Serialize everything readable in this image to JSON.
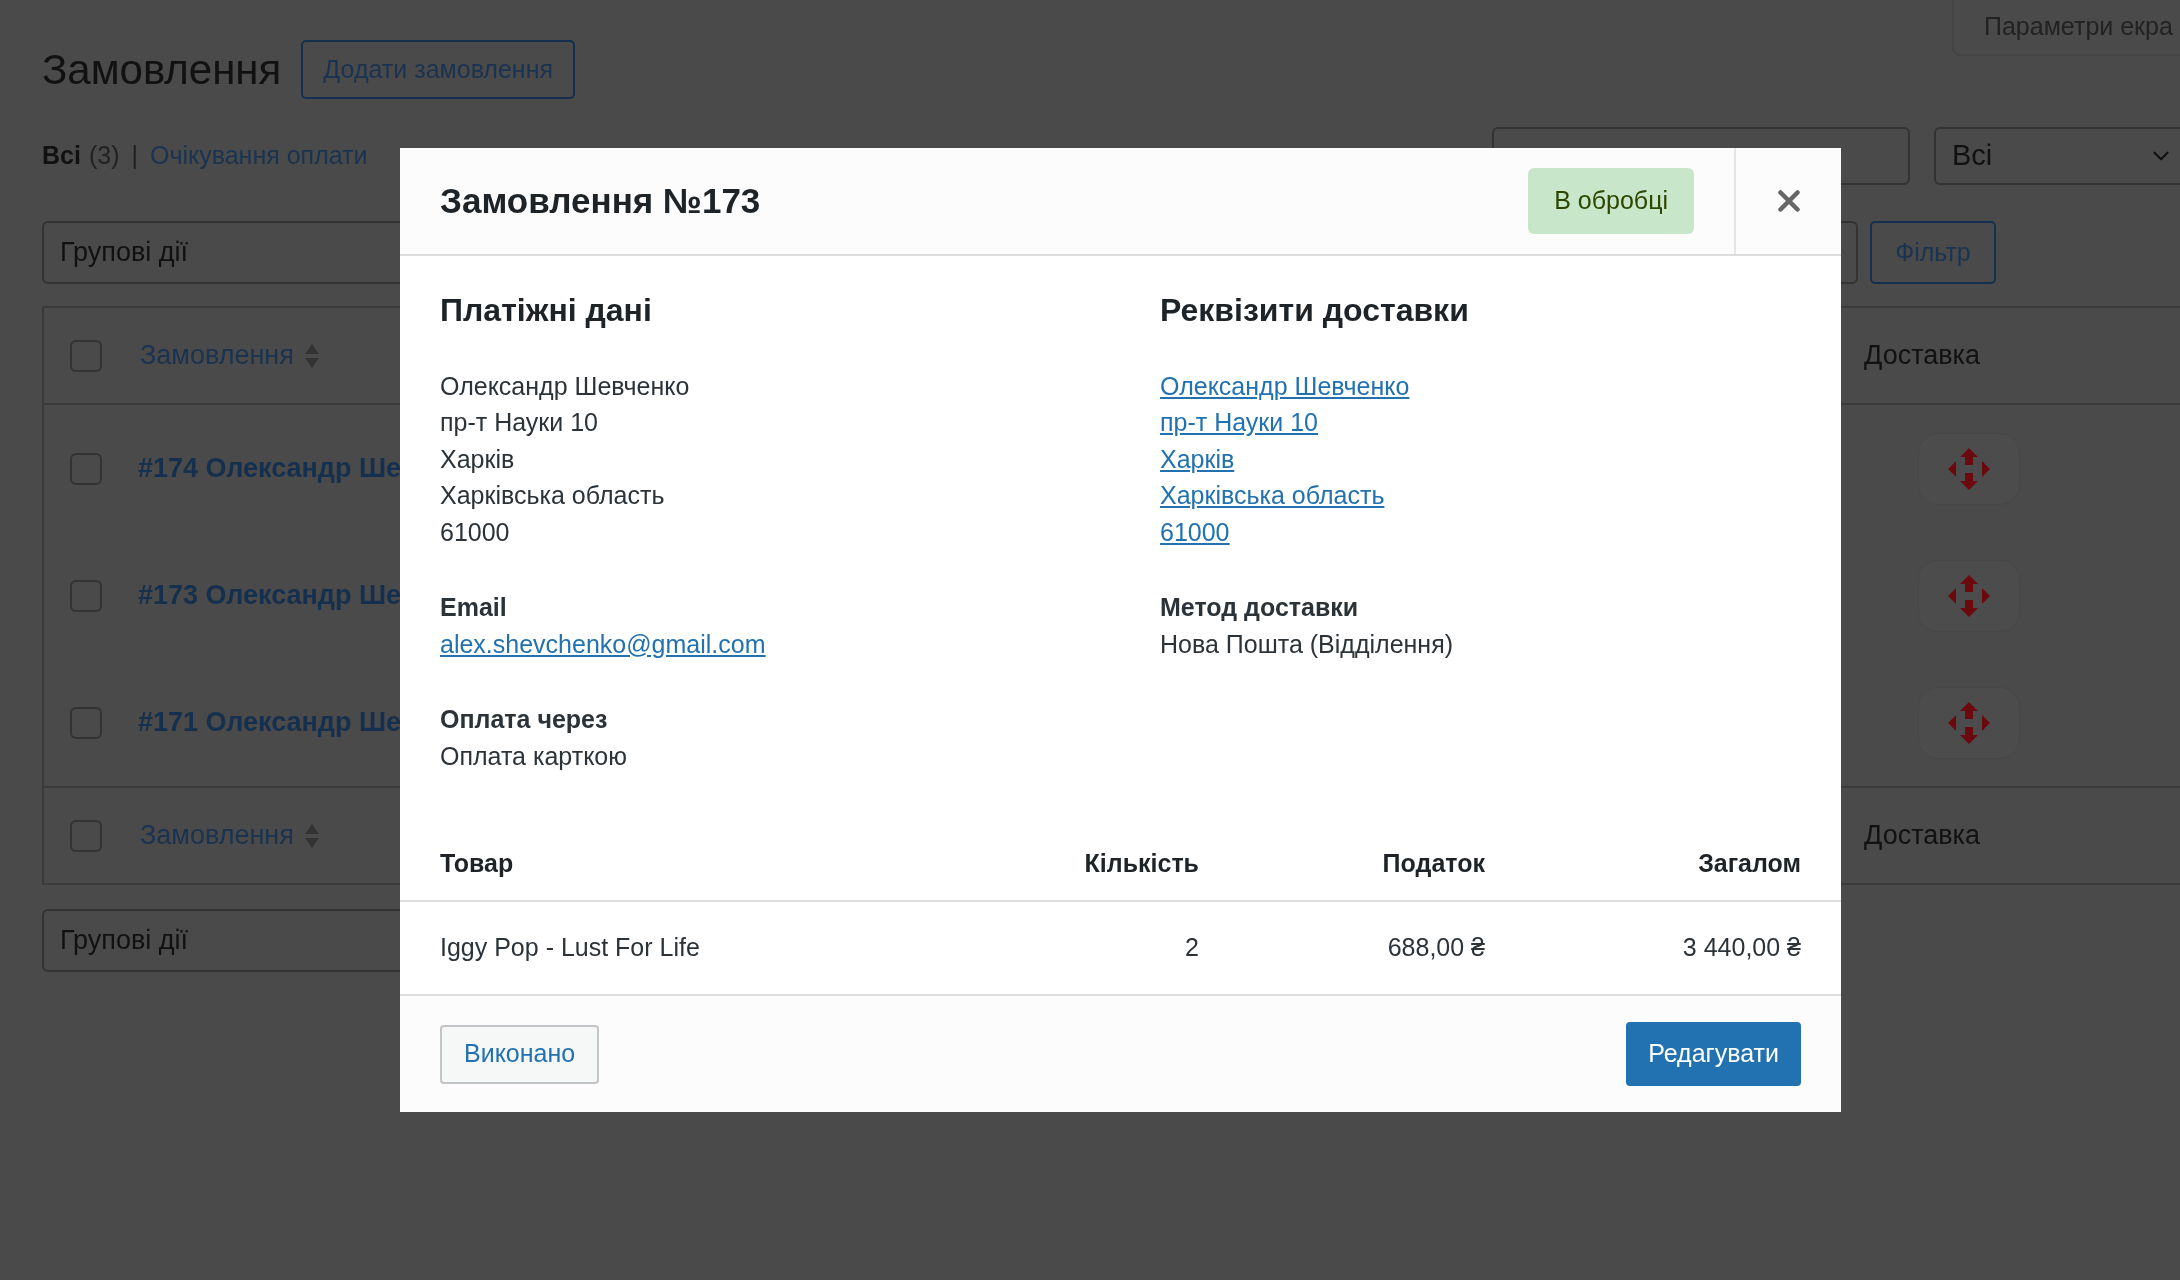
{
  "page": {
    "screen_options": "Параметри екра",
    "title": "Замовлення",
    "add_button": "Додати замовлення",
    "status_links": [
      {
        "label": "Всі",
        "count": "(3)",
        "selected": true
      },
      {
        "separator": "|",
        "label": "Очікування оплати",
        "selected": false
      }
    ],
    "filter_select": "Всі",
    "bulk_actions": "Групові дії",
    "filter_button": "Фільтр",
    "table": {
      "header": {
        "checked": false,
        "column_1": "Замовлення",
        "column_2": "Доставка"
      },
      "rows": [
        {
          "checked": false,
          "order": "#174 Олександр Ше"
        },
        {
          "checked": false,
          "order": "#173 Олександр Ше"
        },
        {
          "checked": false,
          "order": "#171 Олександр Ше"
        }
      ],
      "footer": {
        "checked": false,
        "column_1": "Замовлення",
        "column_2": "Доставка"
      }
    },
    "bulk_actions_bottom": "Групові дії"
  },
  "modal": {
    "title": "Замовлення №173",
    "status": "В обробці",
    "billing": {
      "heading": "Платіжні дані",
      "lines": [
        "Олександр Шевченко",
        "пр-т Науки 10",
        "Харків",
        "Харківська область",
        "61000"
      ],
      "email_label": "Email",
      "email": "alex.shevchenko@gmail.com",
      "payment_label": "Оплата через",
      "payment": "Оплата карткою"
    },
    "shipping": {
      "heading": "Реквізити доставки",
      "lines": [
        "Олександр Шевченко",
        "пр-т Науки 10",
        "Харків",
        "Харківська область",
        "61000"
      ],
      "method_label": "Метод доставки",
      "method": "Нова Пошта (Відділення)"
    },
    "items": {
      "columns": [
        "Товар",
        "Кількість",
        "Податок",
        "Загалом"
      ],
      "rows": [
        {
          "product": "Iggy Pop - Lust For Life",
          "quantity": "2",
          "tax": "688,00 ₴",
          "total": "3 440,00 ₴"
        }
      ]
    },
    "complete_button": "Виконано",
    "edit_button": "Редагувати"
  }
}
